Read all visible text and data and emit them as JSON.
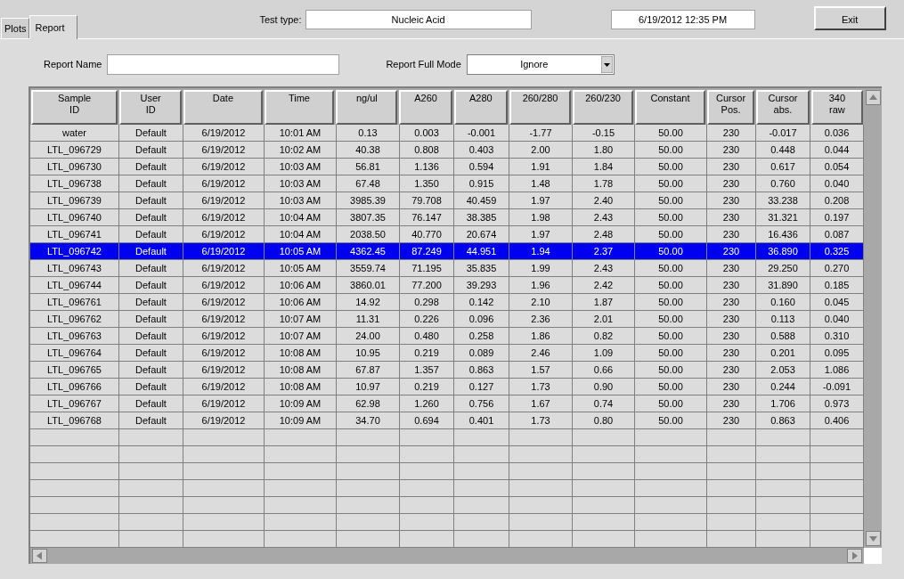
{
  "tabs": [
    {
      "label": "Plots",
      "selected": false
    },
    {
      "label": "Report",
      "selected": true
    }
  ],
  "test_type": {
    "label": "Test type:",
    "value": "Nucleic Acid"
  },
  "datetime": "6/19/2012  12:35 PM",
  "exit_button": "Exit",
  "report_name": {
    "label": "Report Name"
  },
  "report_full_mode": {
    "label": "Report Full Mode",
    "value": "Ignore"
  },
  "table": {
    "columns": [
      "Sample\nID",
      "User\nID",
      "Date",
      "Time",
      "ng/ul",
      "A260",
      "A280",
      "260/280",
      "260/230",
      "Constant",
      "Cursor\nPos.",
      "Cursor\nabs.",
      "340\nraw"
    ],
    "rows": [
      {
        "selected": false,
        "cells": [
          "water",
          "Default",
          "6/19/2012",
          "10:01 AM",
          "0.13",
          "0.003",
          "-0.001",
          "-1.77",
          "-0.15",
          "50.00",
          "230",
          "-0.017",
          "0.036"
        ]
      },
      {
        "selected": false,
        "cells": [
          "LTL_096729",
          "Default",
          "6/19/2012",
          "10:02 AM",
          "40.38",
          "0.808",
          "0.403",
          "2.00",
          "1.80",
          "50.00",
          "230",
          "0.448",
          "0.044"
        ]
      },
      {
        "selected": false,
        "cells": [
          "LTL_096730",
          "Default",
          "6/19/2012",
          "10:03 AM",
          "56.81",
          "1.136",
          "0.594",
          "1.91",
          "1.84",
          "50.00",
          "230",
          "0.617",
          "0.054"
        ]
      },
      {
        "selected": false,
        "cells": [
          "LTL_096738",
          "Default",
          "6/19/2012",
          "10:03 AM",
          "67.48",
          "1.350",
          "0.915",
          "1.48",
          "1.78",
          "50.00",
          "230",
          "0.760",
          "0.040"
        ]
      },
      {
        "selected": false,
        "cells": [
          "LTL_096739",
          "Default",
          "6/19/2012",
          "10:03 AM",
          "3985.39",
          "79.708",
          "40.459",
          "1.97",
          "2.40",
          "50.00",
          "230",
          "33.238",
          "0.208"
        ]
      },
      {
        "selected": false,
        "cells": [
          "LTL_096740",
          "Default",
          "6/19/2012",
          "10:04 AM",
          "3807.35",
          "76.147",
          "38.385",
          "1.98",
          "2.43",
          "50.00",
          "230",
          "31.321",
          "0.197"
        ]
      },
      {
        "selected": false,
        "cells": [
          "LTL_096741",
          "Default",
          "6/19/2012",
          "10:04 AM",
          "2038.50",
          "40.770",
          "20.674",
          "1.97",
          "2.48",
          "50.00",
          "230",
          "16.436",
          "0.087"
        ]
      },
      {
        "selected": true,
        "cells": [
          "LTL_096742",
          "Default",
          "6/19/2012",
          "10:05 AM",
          "4362.45",
          "87.249",
          "44.951",
          "1.94",
          "2.37",
          "50.00",
          "230",
          "36.890",
          "0.325"
        ]
      },
      {
        "selected": false,
        "cells": [
          "LTL_096743",
          "Default",
          "6/19/2012",
          "10:05 AM",
          "3559.74",
          "71.195",
          "35.835",
          "1.99",
          "2.43",
          "50.00",
          "230",
          "29.250",
          "0.270"
        ]
      },
      {
        "selected": false,
        "cells": [
          "LTL_096744",
          "Default",
          "6/19/2012",
          "10:06 AM",
          "3860.01",
          "77.200",
          "39.293",
          "1.96",
          "2.42",
          "50.00",
          "230",
          "31.890",
          "0.185"
        ]
      },
      {
        "selected": false,
        "cells": [
          "LTL_096761",
          "Default",
          "6/19/2012",
          "10:06 AM",
          "14.92",
          "0.298",
          "0.142",
          "2.10",
          "1.87",
          "50.00",
          "230",
          "0.160",
          "0.045"
        ]
      },
      {
        "selected": false,
        "cells": [
          "LTL_096762",
          "Default",
          "6/19/2012",
          "10:07 AM",
          "11.31",
          "0.226",
          "0.096",
          "2.36",
          "2.01",
          "50.00",
          "230",
          "0.113",
          "0.040"
        ]
      },
      {
        "selected": false,
        "cells": [
          "LTL_096763",
          "Default",
          "6/19/2012",
          "10:07 AM",
          "24.00",
          "0.480",
          "0.258",
          "1.86",
          "0.82",
          "50.00",
          "230",
          "0.588",
          "0.310"
        ]
      },
      {
        "selected": false,
        "cells": [
          "LTL_096764",
          "Default",
          "6/19/2012",
          "10:08 AM",
          "10.95",
          "0.219",
          "0.089",
          "2.46",
          "1.09",
          "50.00",
          "230",
          "0.201",
          "0.095"
        ]
      },
      {
        "selected": false,
        "cells": [
          "LTL_096765",
          "Default",
          "6/19/2012",
          "10:08 AM",
          "67.87",
          "1.357",
          "0.863",
          "1.57",
          "0.66",
          "50.00",
          "230",
          "2.053",
          "1.086"
        ]
      },
      {
        "selected": false,
        "cells": [
          "LTL_096766",
          "Default",
          "6/19/2012",
          "10:08 AM",
          "10.97",
          "0.219",
          "0.127",
          "1.73",
          "0.90",
          "50.00",
          "230",
          "0.244",
          "-0.091"
        ]
      },
      {
        "selected": false,
        "cells": [
          "LTL_096767",
          "Default",
          "6/19/2012",
          "10:09 AM",
          "62.98",
          "1.260",
          "0.756",
          "1.67",
          "0.74",
          "50.00",
          "230",
          "1.706",
          "0.973"
        ]
      },
      {
        "selected": false,
        "cells": [
          "LTL_096768",
          "Default",
          "6/19/2012",
          "10:09 AM",
          "34.70",
          "0.694",
          "0.401",
          "1.73",
          "0.80",
          "50.00",
          "230",
          "0.863",
          "0.406"
        ]
      }
    ]
  }
}
